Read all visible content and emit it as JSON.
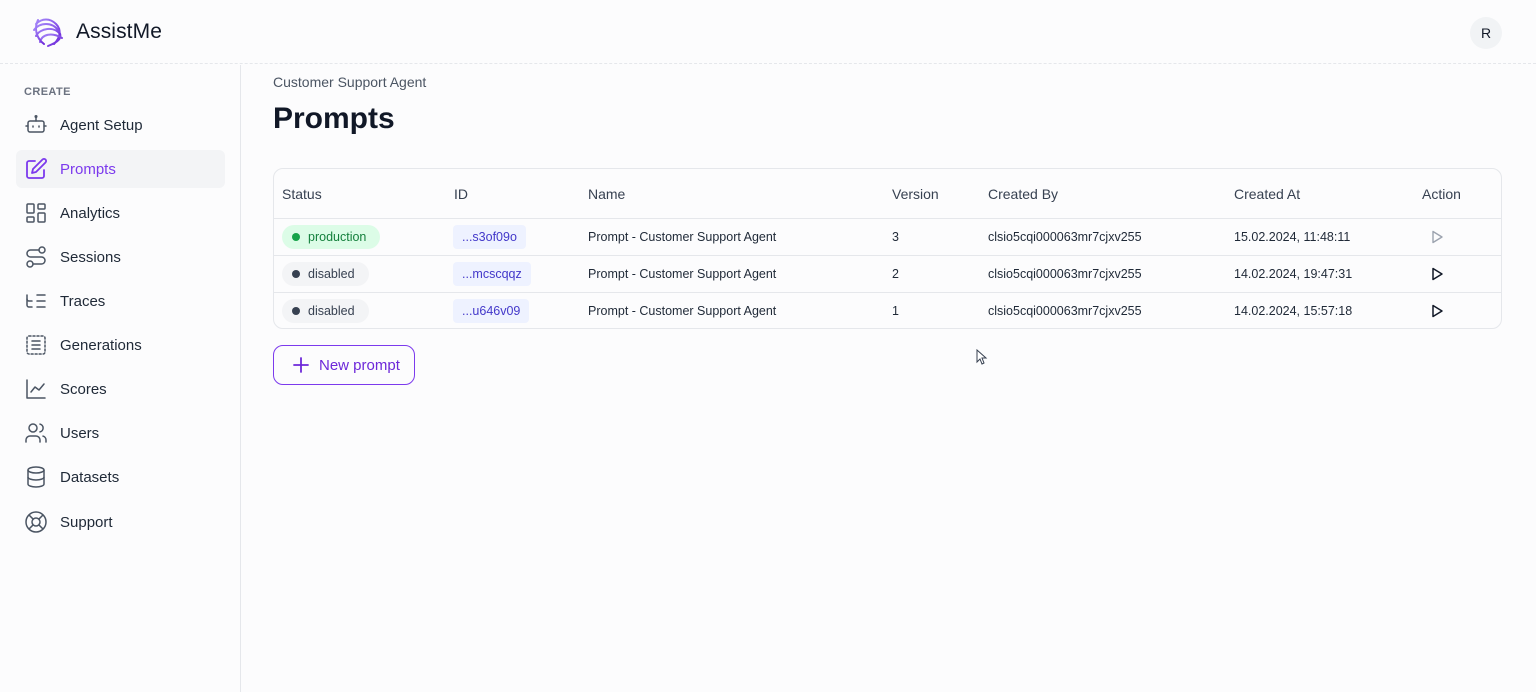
{
  "header": {
    "brand": "AssistMe",
    "avatar_initial": "R",
    "logo_icon": "assistme-logo-icon",
    "accent_color": "#7c3aed"
  },
  "sidebar": {
    "section_label": "CREATE",
    "items": [
      {
        "label": "Agent Setup",
        "icon": "robot-icon",
        "active": false
      },
      {
        "label": "Prompts",
        "icon": "edit-icon",
        "active": true
      },
      {
        "label": "Analytics",
        "icon": "grid-icon",
        "active": false
      },
      {
        "label": "Sessions",
        "icon": "route-icon",
        "active": false
      },
      {
        "label": "Traces",
        "icon": "list-tree-icon",
        "active": false
      },
      {
        "label": "Generations",
        "icon": "list-box-icon",
        "active": false
      },
      {
        "label": "Scores",
        "icon": "line-chart-icon",
        "active": false
      },
      {
        "label": "Users",
        "icon": "users-icon",
        "active": false
      },
      {
        "label": "Datasets",
        "icon": "database-icon",
        "active": false
      },
      {
        "label": "Support",
        "icon": "lifebuoy-icon",
        "active": false
      }
    ]
  },
  "main": {
    "breadcrumb": "Customer Support Agent",
    "title": "Prompts",
    "table": {
      "columns": [
        "Status",
        "ID",
        "Name",
        "Version",
        "Created By",
        "Created At",
        "Action"
      ],
      "rows": [
        {
          "status": "production",
          "id": "...s3of09o",
          "name": "Prompt - Customer Support Agent",
          "version": "3",
          "created_by": "clsio5cqi000063mr7cjxv255",
          "created_at": "15.02.2024, 11:48:11",
          "action_enabled": false
        },
        {
          "status": "disabled",
          "id": "...mcscqqz",
          "name": "Prompt - Customer Support Agent",
          "version": "2",
          "created_by": "clsio5cqi000063mr7cjxv255",
          "created_at": "14.02.2024, 19:47:31",
          "action_enabled": true
        },
        {
          "status": "disabled",
          "id": "...u646v09",
          "name": "Prompt - Customer Support Agent",
          "version": "1",
          "created_by": "clsio5cqi000063mr7cjxv255",
          "created_at": "14.02.2024, 15:57:18",
          "action_enabled": true
        }
      ]
    },
    "new_prompt_label": "New prompt"
  }
}
